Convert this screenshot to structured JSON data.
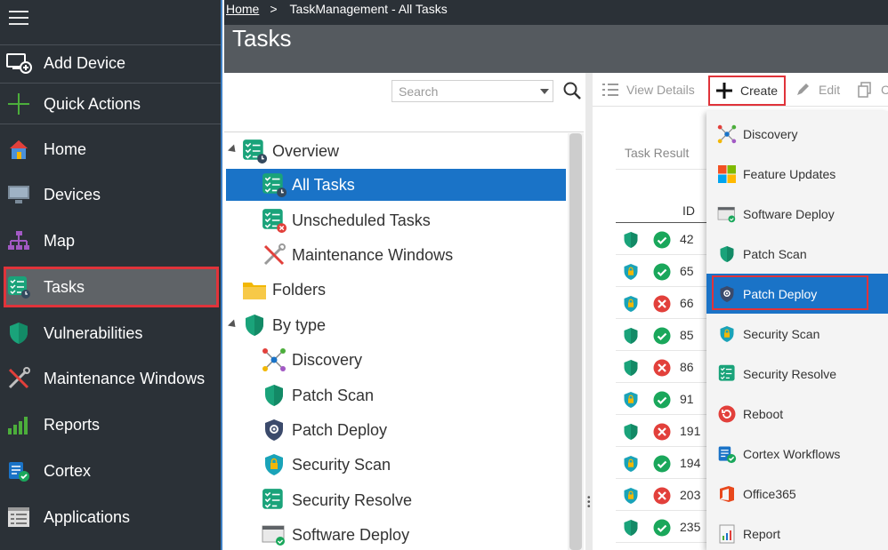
{
  "breadcrumb": {
    "home": "Home",
    "separator": ">",
    "current": "TaskManagement - All Tasks"
  },
  "page": {
    "title": "Tasks"
  },
  "sidebar": {
    "items": [
      {
        "label": "Add Device",
        "icon": "add-device-icon"
      },
      {
        "label": "Quick Actions",
        "icon": "plus-icon"
      },
      {
        "label": "Home",
        "icon": "house-icon"
      },
      {
        "label": "Devices",
        "icon": "monitor-icon"
      },
      {
        "label": "Map",
        "icon": "network-map-icon"
      },
      {
        "label": "Tasks",
        "icon": "task-list-icon"
      },
      {
        "label": "Vulnerabilities",
        "icon": "shield-icon"
      },
      {
        "label": "Maintenance Windows",
        "icon": "tools-icon"
      },
      {
        "label": "Reports",
        "icon": "bar-chart-icon"
      },
      {
        "label": "Cortex",
        "icon": "cortex-icon"
      },
      {
        "label": "Applications",
        "icon": "applications-icon"
      }
    ]
  },
  "search": {
    "placeholder": "Search"
  },
  "tree": {
    "overview": "Overview",
    "all_tasks": "All Tasks",
    "unscheduled": "Unscheduled Tasks",
    "maintenance": "Maintenance Windows",
    "folders": "Folders",
    "by_type": "By type",
    "types": [
      "Discovery",
      "Patch Scan",
      "Patch Deploy",
      "Security Scan",
      "Security Resolve",
      "Software Deploy"
    ]
  },
  "toolbar": {
    "view_details": "View Details",
    "create": "Create",
    "edit": "Edit",
    "more": "C"
  },
  "task_panel": {
    "tab": "Task Result",
    "id_header": "ID",
    "rows": [
      {
        "id": "42",
        "shield": "plain",
        "status": "ok"
      },
      {
        "id": "65",
        "shield": "lock",
        "status": "ok"
      },
      {
        "id": "66",
        "shield": "lock",
        "status": "error"
      },
      {
        "id": "85",
        "shield": "plain",
        "status": "ok"
      },
      {
        "id": "86",
        "shield": "plain",
        "status": "error"
      },
      {
        "id": "91",
        "shield": "lock",
        "status": "ok"
      },
      {
        "id": "191",
        "shield": "plain",
        "status": "error"
      },
      {
        "id": "194",
        "shield": "lock",
        "status": "ok"
      },
      {
        "id": "203",
        "shield": "lock",
        "status": "error"
      },
      {
        "id": "235",
        "shield": "plain",
        "status": "ok"
      }
    ]
  },
  "create_menu": {
    "items": [
      {
        "label": "Discovery",
        "icon": "discovery-icon"
      },
      {
        "label": "Feature Updates",
        "icon": "windows-logo-icon"
      },
      {
        "label": "Software Deploy",
        "icon": "software-deploy-icon"
      },
      {
        "label": "Patch Scan",
        "icon": "shield-icon"
      },
      {
        "label": "Patch Deploy",
        "icon": "patch-deploy-icon"
      },
      {
        "label": "Security Scan",
        "icon": "lock-shield-icon"
      },
      {
        "label": "Security Resolve",
        "icon": "checklist-icon"
      },
      {
        "label": "Reboot",
        "icon": "reboot-icon"
      },
      {
        "label": "Cortex Workflows",
        "icon": "cortex-icon"
      },
      {
        "label": "Office365",
        "icon": "office-logo-icon"
      },
      {
        "label": "Report",
        "icon": "report-icon"
      }
    ],
    "highlighted": "Patch Deploy"
  },
  "colors": {
    "accent": "#1a73c7",
    "highlight_border": "#e0333a",
    "sidebar": "#2b3137",
    "success": "#1aa75b",
    "error": "#e2403b",
    "shield": "#1aa37a"
  }
}
